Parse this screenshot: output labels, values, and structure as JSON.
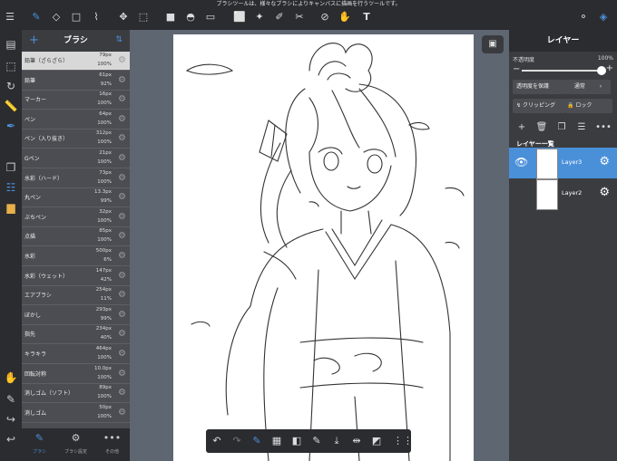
{
  "hint": "ブラシツールは、様々なブラシによりキャンバスに描画を行うツールです。",
  "colors": {
    "accent": "#4a90d9",
    "panel": "#4b4d52",
    "toolbar": "#2b2c30"
  },
  "brush_panel": {
    "title": "ブラシ",
    "brushes": [
      {
        "name": "鉛筆（ざらざら）",
        "size": "79px",
        "opacity": "100%"
      },
      {
        "name": "鉛筆",
        "size": "61px",
        "opacity": "92%"
      },
      {
        "name": "マーカー",
        "size": "16px",
        "opacity": "100%"
      },
      {
        "name": "ペン",
        "size": "64px",
        "opacity": "100%"
      },
      {
        "name": "ペン（入り抜き）",
        "size": "312px",
        "opacity": "100%"
      },
      {
        "name": "Gペン",
        "size": "21px",
        "opacity": "100%"
      },
      {
        "name": "水彩（ハード）",
        "size": "73px",
        "opacity": "100%"
      },
      {
        "name": "丸ペン",
        "size": "13.3px",
        "opacity": "99%"
      },
      {
        "name": "ぶちペン",
        "size": "32px",
        "opacity": "100%"
      },
      {
        "name": "点描",
        "size": "85px",
        "opacity": "100%"
      },
      {
        "name": "水彩",
        "size": "500px",
        "opacity": "6%"
      },
      {
        "name": "水彩（ウェット）",
        "size": "147px",
        "opacity": "42%"
      },
      {
        "name": "エアブラシ",
        "size": "254px",
        "opacity": "11%"
      },
      {
        "name": "ぼかし",
        "size": "293px",
        "opacity": "99%"
      },
      {
        "name": "指先",
        "size": "234px",
        "opacity": "40%"
      },
      {
        "name": "キラキラ",
        "size": "464px",
        "opacity": "100%"
      },
      {
        "name": "回転対称",
        "size": "10.0px",
        "opacity": "100%"
      },
      {
        "name": "消しゴム（ソフト）",
        "size": "89px",
        "opacity": "100%"
      },
      {
        "name": "消しゴム",
        "size": "50px",
        "opacity": "100%"
      }
    ],
    "tabs": [
      {
        "label": "ブラシ"
      },
      {
        "label": "ブラシ設定"
      },
      {
        "label": "その他"
      }
    ]
  },
  "layer_panel": {
    "title": "レイヤー",
    "opacity_label": "不透明度",
    "opacity_value": "100%",
    "opacity_level": 1.0,
    "protect_label": "透明度を保護",
    "blend_label": "通常",
    "clipping_label": "クリッピング",
    "lock_label": "ロック",
    "list_label": "レイヤー一覧",
    "layers": [
      {
        "name": "Layer3"
      },
      {
        "name": "Layer2"
      }
    ]
  }
}
